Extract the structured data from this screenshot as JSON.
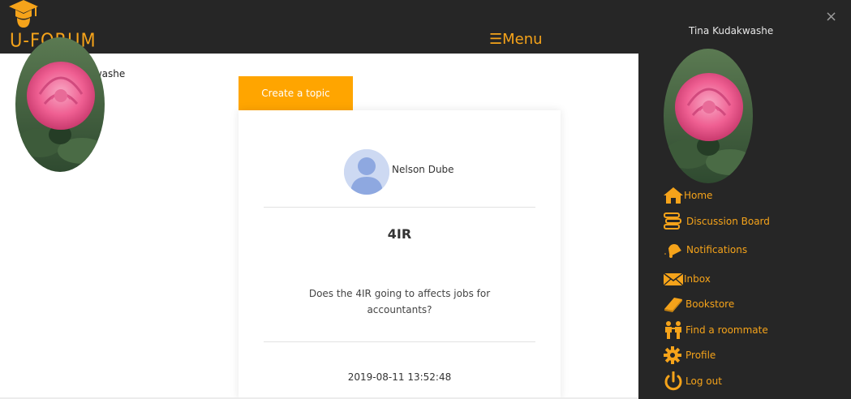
{
  "brand": {
    "name": "U-FORUM"
  },
  "header": {
    "menu_label": "☰Menu"
  },
  "profile": {
    "name": "Tina Kudakwashe"
  },
  "actions": {
    "create_topic_label": "Create a topic"
  },
  "post": {
    "author": "Nelson Dube",
    "title": "4IR",
    "body": "Does the 4IR going to affects jobs for accountants?",
    "date": "2019-08-11 13:52:48"
  },
  "sidenav": {
    "close_label": "×",
    "user_name": "Tina Kudakwashe",
    "items": [
      {
        "label": "Home",
        "icon": "home-icon"
      },
      {
        "label": "Discussion Board",
        "icon": "discussion-board-icon"
      },
      {
        "label": "Notifications",
        "icon": "notifications-icon"
      },
      {
        "label": "Inbox",
        "icon": "inbox-icon"
      },
      {
        "label": "Bookstore",
        "icon": "book-icon"
      },
      {
        "label": "Find a roommate",
        "icon": "roommate-icon"
      },
      {
        "label": "Profile",
        "icon": "profile-gear-icon"
      },
      {
        "label": "Log out",
        "icon": "power-icon"
      }
    ]
  },
  "colors": {
    "accent": "#f5a31a",
    "button": "#ffa500",
    "dark_bar": "#262626"
  }
}
